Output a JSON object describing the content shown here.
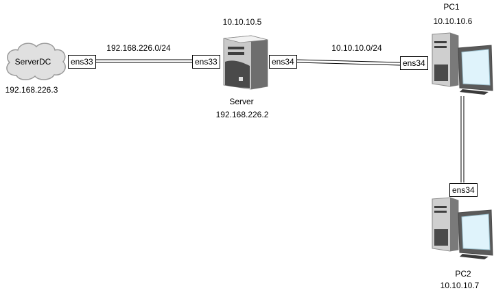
{
  "nodes": {
    "serverdc": {
      "name": "ServerDC",
      "ip": "192.168.226.3"
    },
    "server": {
      "name": "Server",
      "ip_top": "10.10.10.5",
      "ip_bottom": "192.168.226.2"
    },
    "pc1": {
      "name": "PC1",
      "ip": "10.10.10.6"
    },
    "pc2": {
      "name": "PC2",
      "ip": "10.10.10.7"
    }
  },
  "interfaces": {
    "serverdc_ens33": "ens33",
    "server_ens33": "ens33",
    "server_ens34": "ens34",
    "pc1_ens34": "ens34",
    "pc2_ens34": "ens34"
  },
  "networks": {
    "left": "192.168.226.0/24",
    "right": "10.10.10.0/24"
  },
  "colors": {
    "cloud_fill": "#e0e0e0",
    "cloud_stroke": "#9a9a9a",
    "link": "#000000",
    "device_light": "#e8e8e8",
    "device_dark": "#4a4a4a",
    "screen": "#dff3fb"
  }
}
